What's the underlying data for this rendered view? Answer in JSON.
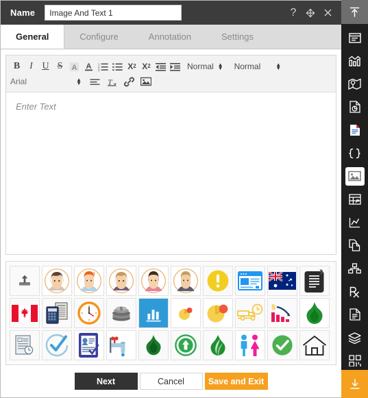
{
  "window": {
    "name_label": "Name",
    "name_value": "Image And Text 1",
    "name_placeholder": "Name",
    "controls": [
      {
        "name": "help-icon",
        "glyph": "?"
      },
      {
        "name": "move-icon",
        "glyph": "move"
      },
      {
        "name": "close-icon",
        "glyph": "close"
      }
    ]
  },
  "tabs": [
    {
      "label": "General",
      "active": true
    },
    {
      "label": "Configure",
      "active": false
    },
    {
      "label": "Annotation",
      "active": false
    },
    {
      "label": "Settings",
      "active": false
    }
  ],
  "toolbar": {
    "row1": [
      {
        "name": "bold-button",
        "label": "B"
      },
      {
        "name": "italic-button",
        "label": "I"
      },
      {
        "name": "underline-button",
        "label": "U"
      },
      {
        "name": "strikethrough-button",
        "label": "S"
      },
      {
        "name": "highlight-color-icon",
        "label": "A"
      },
      {
        "name": "font-color-icon",
        "label": "A"
      },
      {
        "name": "ordered-list-icon",
        "label": ""
      },
      {
        "name": "unordered-list-icon",
        "label": ""
      },
      {
        "name": "subscript-button",
        "label": "X"
      },
      {
        "name": "superscript-button",
        "label": "X"
      },
      {
        "name": "outdent-icon",
        "label": ""
      },
      {
        "name": "indent-icon",
        "label": ""
      }
    ],
    "paragraph_style": "Normal",
    "font_size_style": "Normal",
    "font_family": "Arial",
    "row2": [
      {
        "name": "align-icon",
        "label": ""
      },
      {
        "name": "clear-formatting-icon",
        "label": "Tx"
      },
      {
        "name": "link-icon",
        "label": ""
      },
      {
        "name": "insert-image-icon",
        "label": ""
      }
    ]
  },
  "editor": {
    "placeholder": "Enter Text",
    "value": ""
  },
  "palette": {
    "rows": [
      [
        {
          "name": "upload-icon",
          "glyph": "upload"
        },
        {
          "name": "avatar-woman-brown-hair-icon",
          "glyph": "👩"
        },
        {
          "name": "avatar-man-red-hair-icon",
          "glyph": "👨‍🦰"
        },
        {
          "name": "avatar-woman-blonde-icon",
          "glyph": "👱‍♀️"
        },
        {
          "name": "avatar-boy-dark-hair-icon",
          "glyph": "👦"
        },
        {
          "name": "avatar-man-blonde-icon",
          "glyph": "👱"
        },
        {
          "name": "warning-exclamation-icon",
          "glyph": "warning"
        },
        {
          "name": "browser-window-icon",
          "glyph": "browser"
        },
        {
          "name": "australia-flag-icon",
          "glyph": "flag-au"
        },
        {
          "name": "scroll-document-icon",
          "glyph": "scroll"
        }
      ],
      [
        {
          "name": "canada-flag-icon",
          "glyph": "flag-ca"
        },
        {
          "name": "calculator-icon",
          "glyph": "calculator"
        },
        {
          "name": "clock-icon",
          "glyph": "clock"
        },
        {
          "name": "coins-stack-icon",
          "glyph": "coins"
        },
        {
          "name": "bar-chart-tile-icon",
          "glyph": "barchart"
        },
        {
          "name": "pie-chart-small-icon",
          "glyph": "pie-small"
        },
        {
          "name": "pie-chart-icon",
          "glyph": "pie"
        },
        {
          "name": "delivery-truck-time-icon",
          "glyph": "truck"
        },
        {
          "name": "declining-cost-chart-icon",
          "glyph": "declining"
        },
        {
          "name": "green-flame-icon",
          "glyph": "flame-green"
        }
      ],
      [
        {
          "name": "document-time-icon",
          "glyph": "doc-time"
        },
        {
          "name": "check-circle-outline-icon",
          "glyph": "check-outline"
        },
        {
          "name": "id-form-icon",
          "glyph": "id-form"
        },
        {
          "name": "water-tap-icon",
          "glyph": "tap"
        },
        {
          "name": "dark-flame-icon",
          "glyph": "flame-dark"
        },
        {
          "name": "recycle-arrow-circle-icon",
          "glyph": "recycle"
        },
        {
          "name": "leaf-flame-icon",
          "glyph": "leaf-flame"
        },
        {
          "name": "restroom-icon",
          "glyph": "restroom"
        },
        {
          "name": "green-check-icon",
          "glyph": "check-green"
        },
        {
          "name": "house-outline-icon",
          "glyph": "house"
        }
      ]
    ]
  },
  "footer": {
    "next_label": "Next",
    "cancel_label": "Cancel",
    "save_label": "Save and Exit"
  },
  "rail": {
    "collapse_icon": "collapse-up-icon",
    "items": [
      {
        "name": "rail-item-panel",
        "icon": "panel-icon",
        "active": false
      },
      {
        "name": "rail-item-bar-chart",
        "icon": "bar-chart-icon",
        "active": false
      },
      {
        "name": "rail-item-map",
        "icon": "map-pin-icon",
        "active": false
      },
      {
        "name": "rail-item-pie-document",
        "icon": "pie-document-icon",
        "active": false
      },
      {
        "name": "rail-item-document",
        "icon": "document-icon",
        "active": false
      },
      {
        "name": "rail-item-code",
        "icon": "code-braces-icon",
        "active": false
      },
      {
        "name": "rail-item-image",
        "icon": "image-icon",
        "active": true
      },
      {
        "name": "rail-item-table",
        "icon": "table-icon",
        "active": false
      },
      {
        "name": "rail-item-line-chart",
        "icon": "line-chart-icon",
        "active": false
      },
      {
        "name": "rail-item-copy",
        "icon": "copy-document-icon",
        "active": false
      },
      {
        "name": "rail-item-hierarchy",
        "icon": "hierarchy-icon",
        "active": false
      },
      {
        "name": "rail-item-prescription",
        "icon": "prescription-rx-icon",
        "active": false
      },
      {
        "name": "rail-item-note",
        "icon": "note-document-icon",
        "active": false
      },
      {
        "name": "rail-item-layers",
        "icon": "layers-icon",
        "active": false
      },
      {
        "name": "rail-item-grid",
        "icon": "grid-blocks-icon",
        "active": false
      }
    ],
    "download_icon": "download-icon"
  },
  "colors": {
    "titlebar": "#3c3c3c",
    "tabbar": "#dcdcdc",
    "accent_orange": "#f5a01e",
    "rail": "#1f1f1f",
    "next_button": "#333333"
  }
}
